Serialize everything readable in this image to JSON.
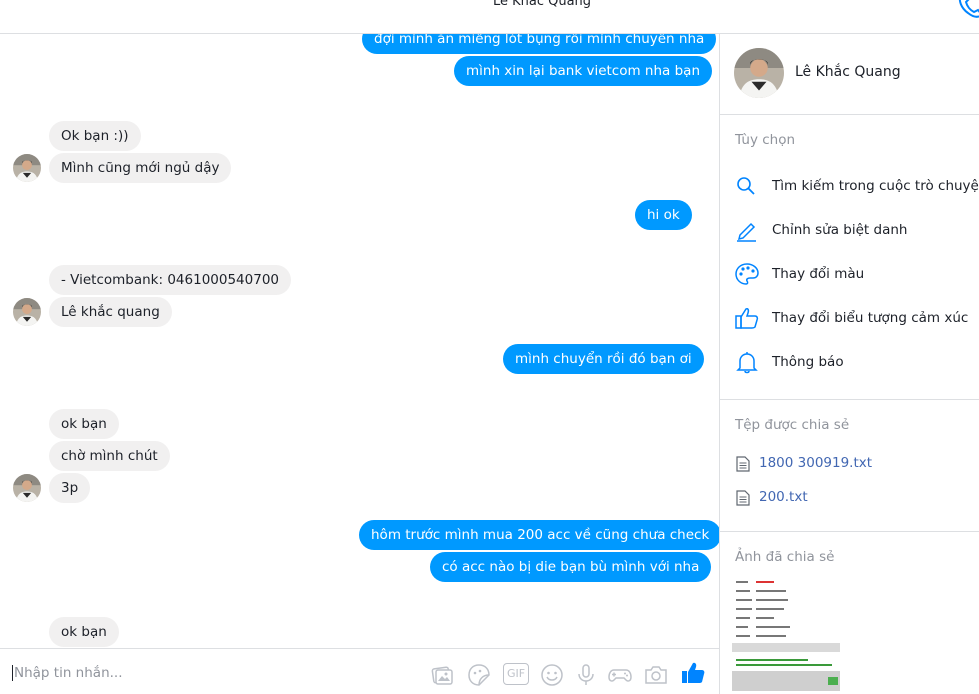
{
  "header": {
    "title": "Lê Khắc Quang"
  },
  "messages": [
    {
      "dir": "out",
      "text": "đợi mình ăn miếng lót bụng rồi mình chuyển nha"
    },
    {
      "dir": "out",
      "text": "mình xin lại bank vietcom nha bạn"
    },
    {
      "dir": "in",
      "text": "Ok bạn :))"
    },
    {
      "dir": "in",
      "text": "Mình cũng mới ngủ dậy"
    },
    {
      "dir": "out",
      "text": "hi ok"
    },
    {
      "dir": "in",
      "text": "- Vietcombank: 0461000540700"
    },
    {
      "dir": "in",
      "text": "Lê khắc quang"
    },
    {
      "dir": "out",
      "text": "mình chuyển rồi đó bạn ơi"
    },
    {
      "dir": "in",
      "text": "ok bạn"
    },
    {
      "dir": "in",
      "text": "chờ mình chút"
    },
    {
      "dir": "in",
      "text": "3p"
    },
    {
      "dir": "out",
      "text": "hôm trước mình mua 200 acc về cũng chưa check"
    },
    {
      "dir": "out",
      "text": "có acc nào bị die bạn bù mình với nha"
    },
    {
      "dir": "in",
      "text": "ok bạn"
    }
  ],
  "sidebar": {
    "name": "Lê Khắc Quang",
    "options_title": "Tùy chọn",
    "options": [
      {
        "label": "Tìm kiếm trong cuộc trò chuyện",
        "icon": "search-icon"
      },
      {
        "label": "Chỉnh sửa biệt danh",
        "icon": "pencil-icon"
      },
      {
        "label": "Thay đổi màu",
        "icon": "palette-icon"
      },
      {
        "label": "Thay đổi biểu tượng cảm xúc",
        "icon": "thumbs-up-icon"
      },
      {
        "label": "Thông báo",
        "icon": "bell-icon"
      }
    ],
    "files_title": "Tệp được chia sẻ",
    "files": [
      "1800 300919.txt",
      "200.txt"
    ],
    "photos_title": "Ảnh đã chia sẻ"
  },
  "composer": {
    "placeholder": "Nhập tin nhắn...",
    "gif_label": "GIF"
  },
  "colors": {
    "accent": "#0099ff",
    "incoming_bubble": "#f1f0f0",
    "link": "#4267b2",
    "muted": "#90949c",
    "border": "#dddfe2"
  }
}
